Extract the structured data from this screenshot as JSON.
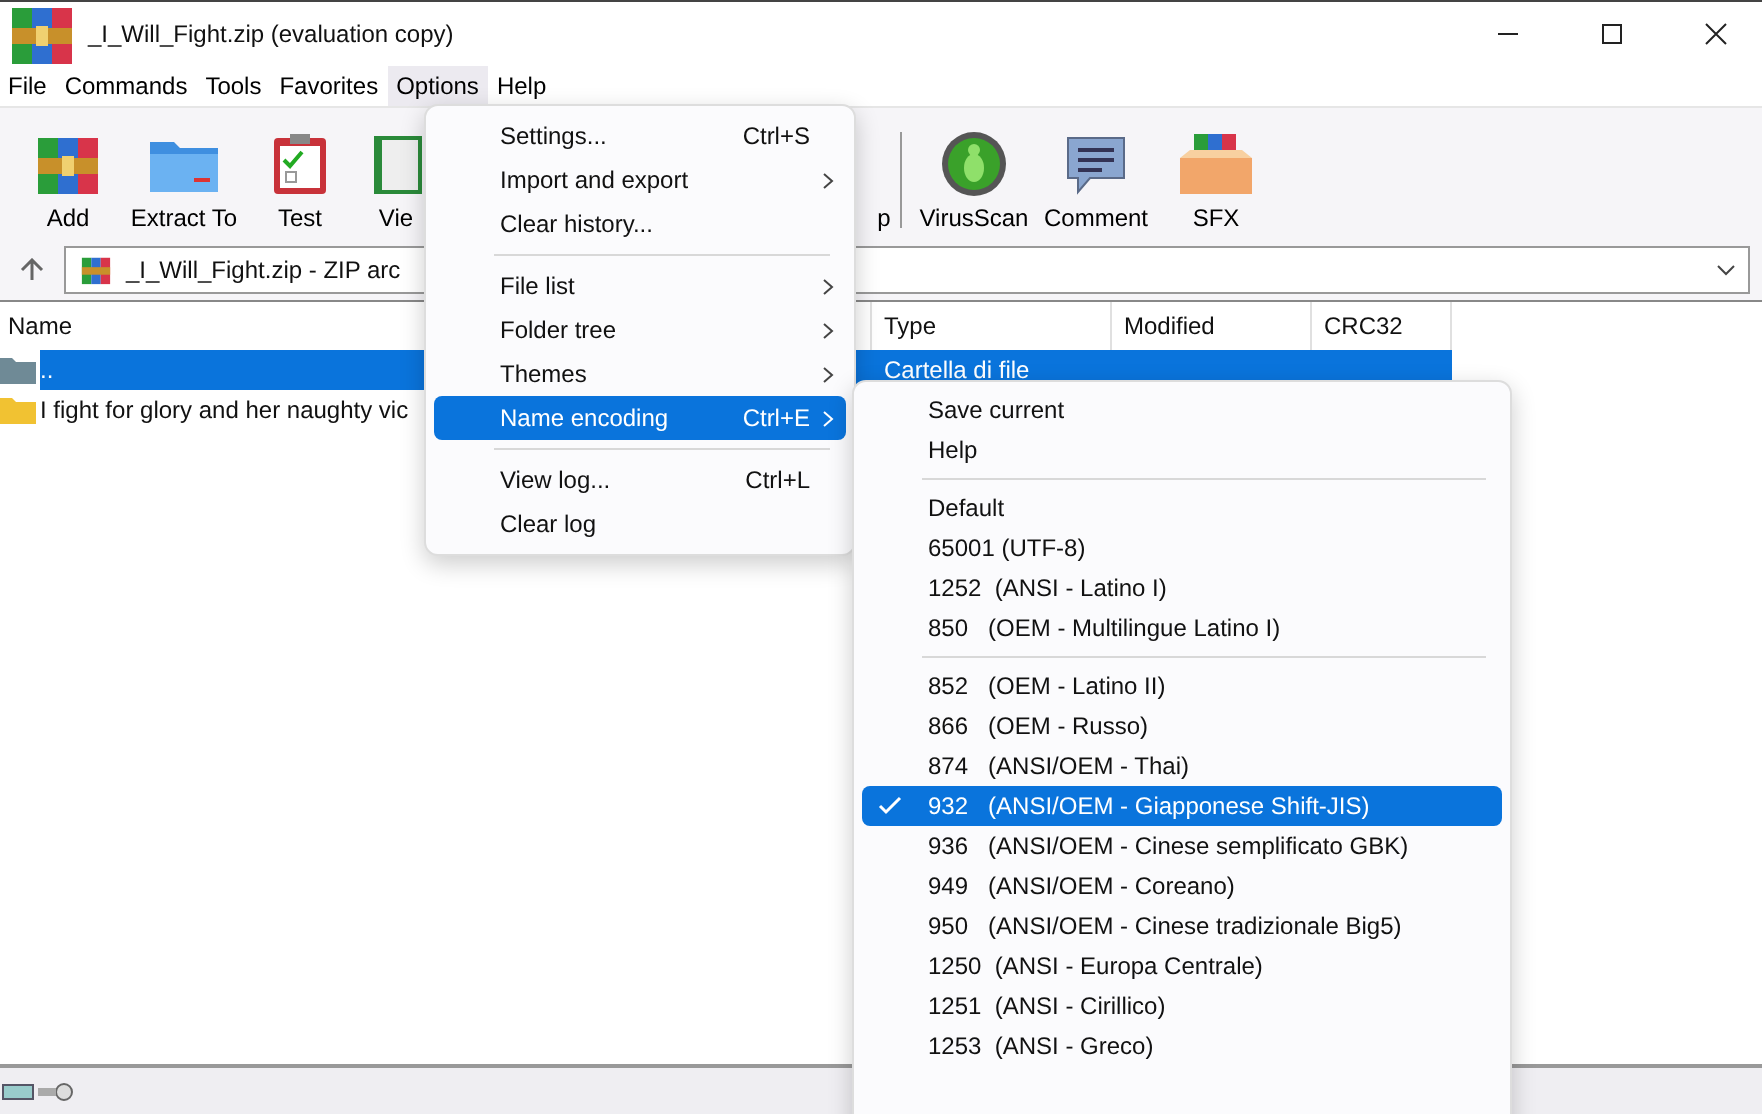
{
  "window": {
    "title": "_I_Will_Fight.zip (evaluation copy)"
  },
  "menu_bar": [
    {
      "label": "File",
      "selected": false
    },
    {
      "label": "Commands",
      "selected": false
    },
    {
      "label": "Tools",
      "selected": false
    },
    {
      "label": "Favorites",
      "selected": false
    },
    {
      "label": "Options",
      "selected": true
    },
    {
      "label": "Help",
      "selected": false
    }
  ],
  "toolbar": [
    {
      "label": "Add",
      "kind": "books"
    },
    {
      "label": "Extract To",
      "kind": "folder"
    },
    {
      "label": "Test",
      "kind": "clipboard"
    },
    {
      "label": "Vie",
      "kind": "book"
    },
    {
      "label": "p",
      "kind": "none"
    },
    {
      "label": "VirusScan",
      "kind": "bug"
    },
    {
      "label": "Comment",
      "kind": "comment"
    },
    {
      "label": "SFX",
      "kind": "box"
    }
  ],
  "address": {
    "value": "_I_Will_Fight.zip - ZIP arc"
  },
  "table": {
    "columns": [
      "Name",
      "Type",
      "Modified",
      "CRC32"
    ],
    "rows": [
      {
        "name": "..",
        "type": "Cartella di file",
        "selected": true,
        "kind": "up"
      },
      {
        "name": "I fight for glory and her naughty vic",
        "type": "",
        "selected": false,
        "kind": "folder"
      }
    ]
  },
  "options_menu": [
    {
      "kind": "item",
      "label": "Settings...",
      "shortcut": "Ctrl+S",
      "submenu": false,
      "selected": false
    },
    {
      "kind": "item",
      "label": "Import and export",
      "submenu": true,
      "selected": false
    },
    {
      "kind": "item",
      "label": "Clear history...",
      "submenu": false,
      "selected": false
    },
    {
      "kind": "separator"
    },
    {
      "kind": "item",
      "label": "File list",
      "submenu": true,
      "selected": false
    },
    {
      "kind": "item",
      "label": "Folder tree",
      "submenu": true,
      "selected": false
    },
    {
      "kind": "item",
      "label": "Themes",
      "submenu": true,
      "selected": false
    },
    {
      "kind": "item",
      "label": "Name encoding",
      "shortcut": "Ctrl+E",
      "submenu": true,
      "selected": true
    },
    {
      "kind": "separator"
    },
    {
      "kind": "item",
      "label": "View log...",
      "shortcut": "Ctrl+L",
      "submenu": false,
      "selected": false
    },
    {
      "kind": "item",
      "label": "Clear log",
      "submenu": false,
      "selected": false
    }
  ],
  "encoding_menu": [
    {
      "kind": "item",
      "label": "Save current",
      "checked": false,
      "selected": false
    },
    {
      "kind": "item",
      "label": "Help",
      "checked": false,
      "selected": false
    },
    {
      "kind": "separator"
    },
    {
      "kind": "item",
      "label": "Default",
      "checked": false,
      "selected": false
    },
    {
      "kind": "item",
      "label": "65001 (UTF-8)",
      "checked": false,
      "selected": false
    },
    {
      "kind": "item",
      "label": "1252  (ANSI - Latino I)",
      "checked": false,
      "selected": false
    },
    {
      "kind": "item",
      "label": "850   (OEM - Multilingue Latino I)",
      "checked": false,
      "selected": false
    },
    {
      "kind": "separator"
    },
    {
      "kind": "item",
      "label": "852   (OEM - Latino II)",
      "checked": false,
      "selected": false
    },
    {
      "kind": "item",
      "label": "866   (OEM - Russo)",
      "checked": false,
      "selected": false
    },
    {
      "kind": "item",
      "label": "874   (ANSI/OEM - Thai)",
      "checked": false,
      "selected": false
    },
    {
      "kind": "item",
      "label": "932   (ANSI/OEM - Giapponese Shift-JIS)",
      "checked": true,
      "selected": true
    },
    {
      "kind": "item",
      "label": "936   (ANSI/OEM - Cinese semplificato GBK)",
      "checked": false,
      "selected": false
    },
    {
      "kind": "item",
      "label": "949   (ANSI/OEM - Coreano)",
      "checked": false,
      "selected": false
    },
    {
      "kind": "item",
      "label": "950   (ANSI/OEM - Cinese tradizionale Big5)",
      "checked": false,
      "selected": false
    },
    {
      "kind": "item",
      "label": "1250  (ANSI - Europa Centrale)",
      "checked": false,
      "selected": false
    },
    {
      "kind": "item",
      "label": "1251  (ANSI - Cirillico)",
      "checked": false,
      "selected": false
    },
    {
      "kind": "item",
      "label": "1253  (ANSI - Greco)",
      "checked": false,
      "selected": false
    }
  ]
}
